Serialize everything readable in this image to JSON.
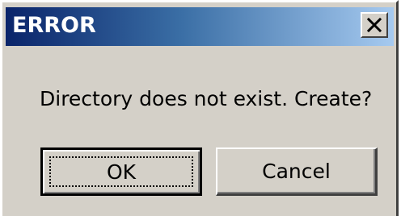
{
  "dialog": {
    "title": "ERROR",
    "message": "Directory does not exist. Create?",
    "close_icon": "close-x-icon",
    "buttons": {
      "ok_label": "OK",
      "cancel_label": "Cancel"
    }
  },
  "colors": {
    "titlebar_start": "#0a246a",
    "titlebar_end": "#a6caf0",
    "face": "#d4d0c8"
  }
}
